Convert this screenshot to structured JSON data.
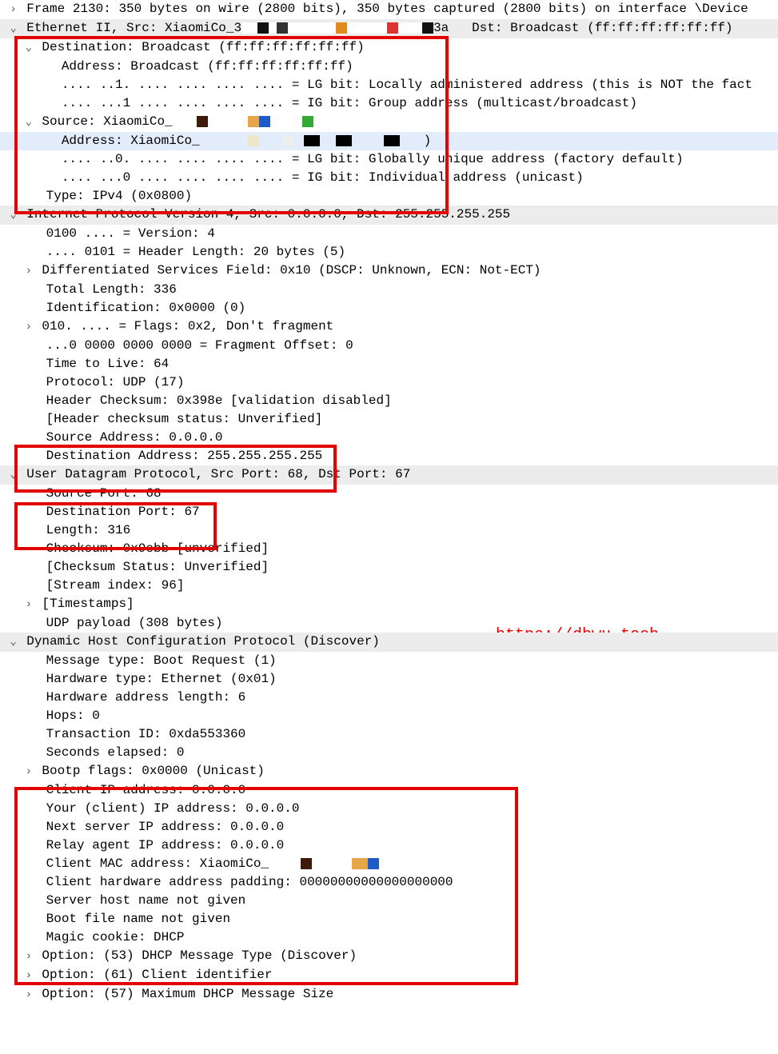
{
  "watermark_text": "https://dbwu.tech",
  "frame": {
    "line": "Frame 2130: 350 bytes on wire (2800 bits), 350 bytes captured (2800 bits) on interface \\Device"
  },
  "eth": {
    "header_prefix": "Ethernet II, Src: XiaomiCo_3",
    "header_suffix": "3a   Dst: Broadcast (ff:ff:ff:ff:ff:ff)",
    "dst": {
      "title": "Destination: Broadcast (ff:ff:ff:ff:ff:ff)",
      "addr": "Address: Broadcast (ff:ff:ff:ff:ff:ff)",
      "lg_prefix": ".... ..1. .... .... .... .... = LG bit: Locally a",
      "lg_suffix": "dministered address (this is NOT the fact",
      "ig_prefix": ".... ...1 .... .... .... .... = IG bit: Group add",
      "ig_suffix": "ress (multicast/broadcast)"
    },
    "src": {
      "title": "Source: XiaomiCo_",
      "addr": "Address: XiaomiCo_",
      "addr_suffix": ")",
      "lg_prefix": ".... ..0. .... .... .... .... = LG bit: Globally ",
      "lg_suffix": "unique address (factory default)",
      "ig_prefix": ".... ...0 .... .... .... .... = IG bit: Individua",
      "ig_suffix": "l address (unicast)"
    },
    "type": "Type: IPv4 (0x0800)"
  },
  "ip": {
    "header": "Internet Protocol Version 4, Src: 0.0.0.0, Dst: 255.255.255.255",
    "version": "0100 .... = Version: 4",
    "hlen": ".... 0101 = Header Length: 20 bytes (5)",
    "dsf": "Differentiated Services Field: 0x10 (DSCP: Unknown, ECN: Not-ECT)",
    "totlen": "Total Length: 336",
    "id": "Identification: 0x0000 (0)",
    "flags": "010. .... = Flags: 0x2, Don't fragment",
    "frag": "...0 0000 0000 0000 = Fragment Offset: 0",
    "ttl": "Time to Live: 64",
    "proto": "Protocol: UDP (17)",
    "cksum": "Header Checksum: 0x398e [validation disabled]",
    "cksumstat": "[Header checksum status: Unverified]",
    "srcaddr": "Source Address: 0.0.0.0",
    "dstaddr": "Destination Address: 255.255.255.255"
  },
  "udp": {
    "header": "User Datagram Protocol, Src Port: 68, Dst Port: 67",
    "srcport": "Source Port: 68",
    "dstport": "Destination Port: 67",
    "len": "Length: 316",
    "cksum": "Checksum: 0x9ebb [unverified]",
    "cksumstat": "[Checksum Status: Unverified]",
    "stream": "[Stream index: 96]",
    "ts": "[Timestamps]",
    "payload": "UDP payload (308 bytes)"
  },
  "dhcp": {
    "header": "Dynamic Host Configuration Protocol (Discover)",
    "msgtype": "Message type: Boot Request (1)",
    "hwtype": "Hardware type: Ethernet (0x01)",
    "hwlen": "Hardware address length: 6",
    "hops": "Hops: 0",
    "xid": "Transaction ID: 0xda553360",
    "secs": "Seconds elapsed: 0",
    "bootp": "Bootp flags: 0x0000 (Unicast)",
    "ciaddr": "Client IP address: 0.0.0.0",
    "yiaddr": "Your (client) IP address: 0.0.0.0",
    "siaddr": "Next server IP address: 0.0.0.0",
    "giaddr": "Relay agent IP address: 0.0.0.0",
    "chaddr": "Client MAC address: XiaomiCo_",
    "chpad": "Client hardware address padding: 00000000000000000000",
    "sname": "Server host name not given",
    "fname": "Boot file name not given",
    "cookie": "Magic cookie: DHCP",
    "opt53": "Option: (53) DHCP Message Type (Discover)",
    "opt61": "Option: (61) Client identifier",
    "opt57": "Option: (57) Maximum DHCP Message Size"
  }
}
